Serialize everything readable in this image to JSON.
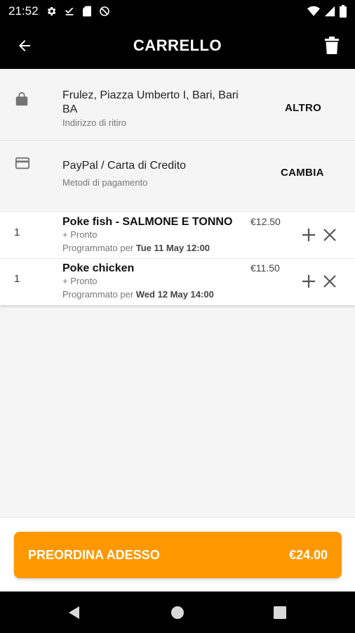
{
  "status_bar": {
    "time": "21:52",
    "icons": [
      "settings-icon",
      "download-done-icon",
      "sd-card-icon",
      "no-data-icon",
      "wifi-icon",
      "signal-icon",
      "battery-icon"
    ]
  },
  "header": {
    "title": "CARRELLO",
    "back_icon": "arrow-back-icon",
    "delete_icon": "trash-icon"
  },
  "pickup": {
    "address": "Frulez, Piazza Umberto I, Bari, Bari BA",
    "label": "Indirizzo di ritiro",
    "action": "ALTRO",
    "icon": "shopping-bag-icon"
  },
  "payment": {
    "method": "PayPal / Carta di Credito",
    "label": "Metodi di pagamento",
    "action": "CAMBIA",
    "icon": "credit-card-icon"
  },
  "cart": {
    "items": [
      {
        "qty": "1",
        "name": "Poke fish - SALMONE E TONNO",
        "price": "€12.50",
        "option": "+ Pronto",
        "schedule_prefix": "Programmato per ",
        "schedule_time": "Tue 11 May 12:00"
      },
      {
        "qty": "1",
        "name": "Poke chicken",
        "price": "€11.50",
        "option": "+ Pronto",
        "schedule_prefix": "Programmato per ",
        "schedule_time": "Wed 12 May 14:00"
      }
    ]
  },
  "order_button": {
    "label": "PREORDINA ADESSO",
    "total": "€24.00",
    "color": "#ff9800"
  },
  "nav_bar": {
    "icons": [
      "back-triangle-icon",
      "home-circle-icon",
      "recents-square-icon"
    ]
  }
}
